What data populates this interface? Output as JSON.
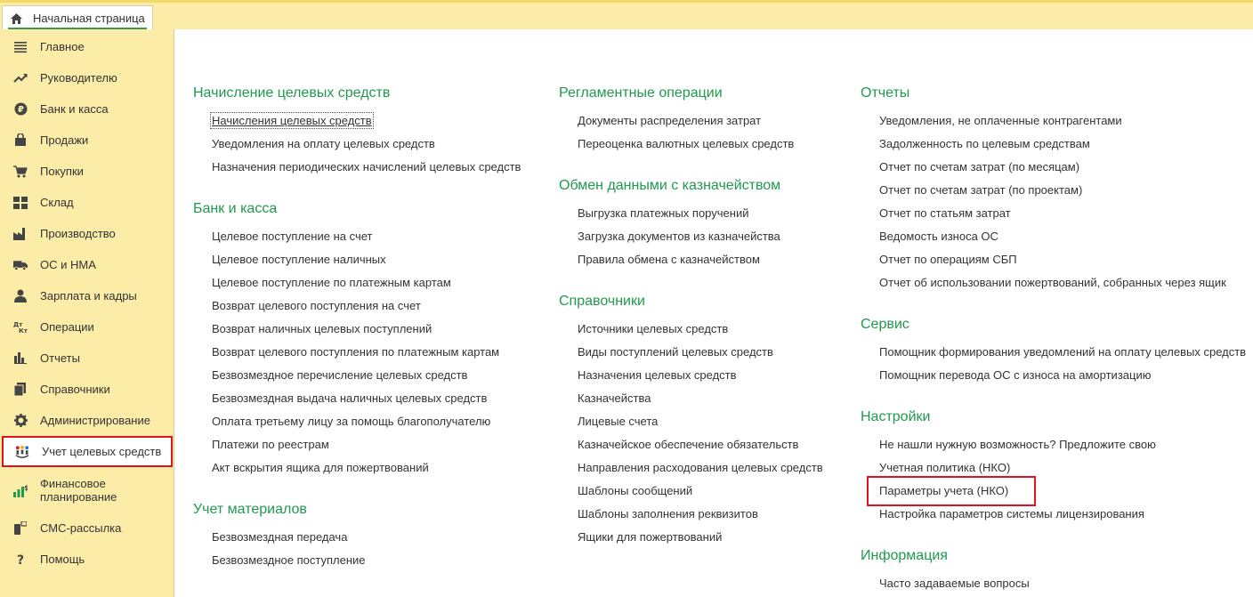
{
  "tab": {
    "label": "Начальная страница",
    "icon": "home-icon"
  },
  "sidebar": {
    "items": [
      {
        "label": "Главное",
        "icon": "menu-lines-icon"
      },
      {
        "label": "Руководителю",
        "icon": "trend-up-icon"
      },
      {
        "label": "Банк и касса",
        "icon": "ruble-coin-icon"
      },
      {
        "label": "Продажи",
        "icon": "shopping-bag-icon"
      },
      {
        "label": "Покупки",
        "icon": "cart-icon"
      },
      {
        "label": "Склад",
        "icon": "warehouse-grid-icon"
      },
      {
        "label": "Производство",
        "icon": "factory-icon"
      },
      {
        "label": "ОС и НМА",
        "icon": "truck-icon"
      },
      {
        "label": "Зарплата и кадры",
        "icon": "person-icon"
      },
      {
        "label": "Операции",
        "icon": "dt-kt-icon"
      },
      {
        "label": "Отчеты",
        "icon": "bar-chart-icon"
      },
      {
        "label": "Справочники",
        "icon": "books-icon"
      },
      {
        "label": "Администрирование",
        "icon": "gear-icon"
      },
      {
        "label": "Учет целевых средств",
        "icon": "people-group-icon",
        "active": true
      },
      {
        "label_line1": "Финансовое",
        "label_line2": "планирование",
        "icon": "finance-chart-icon"
      },
      {
        "label": "СМС-рассылка",
        "icon": "phone-sms-icon"
      },
      {
        "label": "Помощь",
        "icon": "question-icon"
      }
    ]
  },
  "columns": [
    {
      "groups": [
        {
          "title": "Начисление целевых средств",
          "links": [
            "Начисления целевых средств",
            "Уведомления на оплату целевых средств",
            "Назначения периодических начислений целевых средств"
          ]
        },
        {
          "title": "Банк и касса",
          "links": [
            "Целевое поступление на счет",
            "Целевое поступление наличных",
            "Целевое поступление по платежным картам",
            "Возврат целевого поступления на счет",
            "Возврат наличных целевых поступлений",
            "Возврат целевого поступления по платежным картам",
            "Безвозмездное перечисление целевых средств",
            "Безвозмездная выдача наличных целевых средств",
            "Оплата третьему лицу за помощь благополучателю",
            "Платежи по реестрам",
            "Акт вскрытия ящика для пожертвований"
          ]
        },
        {
          "title": "Учет материалов",
          "links": [
            "Безвозмездная передача",
            "Безвозмездное поступление"
          ]
        }
      ]
    },
    {
      "groups": [
        {
          "title": "Регламентные операции",
          "links": [
            "Документы распределения затрат",
            "Переоценка валютных целевых средств"
          ]
        },
        {
          "title": "Обмен данными с казначейством",
          "links": [
            "Выгрузка платежных поручений",
            "Загрузка документов из казначейства",
            "Правила обмена с казначейством"
          ]
        },
        {
          "title": "Справочники",
          "links": [
            "Источники целевых средств",
            "Виды поступлений целевых средств",
            "Назначения целевых средств",
            "Казначейства",
            "Лицевые счета",
            "Казначейское обеспечение обязательств",
            "Направления расходования целевых средств",
            "Шаблоны сообщений",
            "Шаблоны заполнения реквизитов",
            "Ящики для пожертвований"
          ]
        }
      ]
    },
    {
      "groups": [
        {
          "title": "Отчеты",
          "links": [
            "Уведомления, не оплаченные контрагентами",
            "Задолженность по целевым средствам",
            "Отчет по счетам затрат (по месяцам)",
            "Отчет по счетам затрат (по проектам)",
            "Отчет по статьям затрат",
            "Ведомость износа ОС",
            "Отчет по операциям СБП",
            "Отчет об использовании пожертвований, собранных через ящик"
          ]
        },
        {
          "title": "Сервис",
          "links": [
            "Помощник формирования уведомлений на оплату целевых средств",
            "Помощник перевода ОС с износа на амортизацию"
          ]
        },
        {
          "title": "Настройки",
          "links": [
            "Не нашли нужную возможность? Предложите свою",
            "Учетная политика (НКО)",
            "Параметры учета (НКО)",
            "Настройка параметров системы лицензирования"
          ]
        },
        {
          "title": "Информация",
          "links": [
            "Часто задаваемые вопросы"
          ]
        }
      ]
    }
  ],
  "colors": {
    "accent_green": "#1f9a4e",
    "highlight_red": "#e0141e",
    "panel_yellow": "#fbeca8"
  }
}
